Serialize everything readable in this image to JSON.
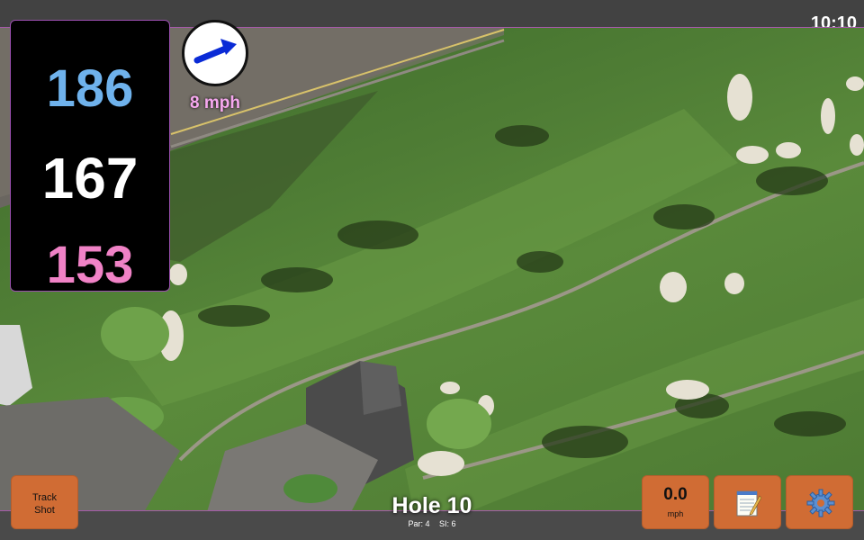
{
  "status": {
    "time": "10:10"
  },
  "distances": {
    "back": "186",
    "middle": "167",
    "front": "153"
  },
  "wind": {
    "speed": "8 mph",
    "direction_icon": "arrow-right-up-icon"
  },
  "buttons": {
    "track_shot_line1": "Track",
    "track_shot_line2": "Shot",
    "speed_value": "0.0",
    "speed_unit": "mph",
    "notes_icon": "notepad-icon",
    "settings_icon": "gear-icon"
  },
  "hole": {
    "title": "Hole 10",
    "par": "Par: 4",
    "si": "SI: 6"
  },
  "colors": {
    "accent": "#d06c34",
    "back_distance": "#6fb2ec",
    "middle_distance": "#ffffff",
    "front_distance": "#f082c6",
    "wind_label": "#f6a8ef"
  }
}
